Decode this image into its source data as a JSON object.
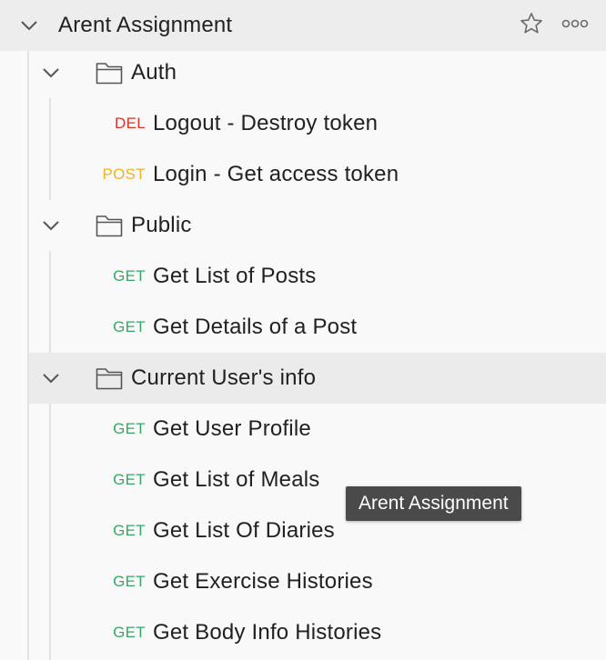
{
  "collection": {
    "name": "Arent Assignment",
    "star_icon": "star-icon",
    "more_icon": "more-horizontal-icon"
  },
  "folders": [
    {
      "name": "Auth",
      "requests": [
        {
          "method": "DEL",
          "name": "Logout - Destroy token"
        },
        {
          "method": "POST",
          "name": "Login - Get access token"
        }
      ]
    },
    {
      "name": "Public",
      "requests": [
        {
          "method": "GET",
          "name": "Get List of Posts"
        },
        {
          "method": "GET",
          "name": "Get Details of a Post"
        }
      ]
    },
    {
      "name": "Current User's info",
      "requests": [
        {
          "method": "GET",
          "name": "Get User Profile"
        },
        {
          "method": "GET",
          "name": "Get List of Meals"
        },
        {
          "method": "GET",
          "name": "Get List Of Diaries"
        },
        {
          "method": "GET",
          "name": "Get Exercise Histories"
        },
        {
          "method": "GET",
          "name": "Get Body Info Histories"
        }
      ]
    }
  ],
  "tooltip": {
    "text": "Arent Assignment"
  },
  "colors": {
    "get": "#3aa664",
    "del": "#d9342b",
    "post": "#eeb422"
  }
}
